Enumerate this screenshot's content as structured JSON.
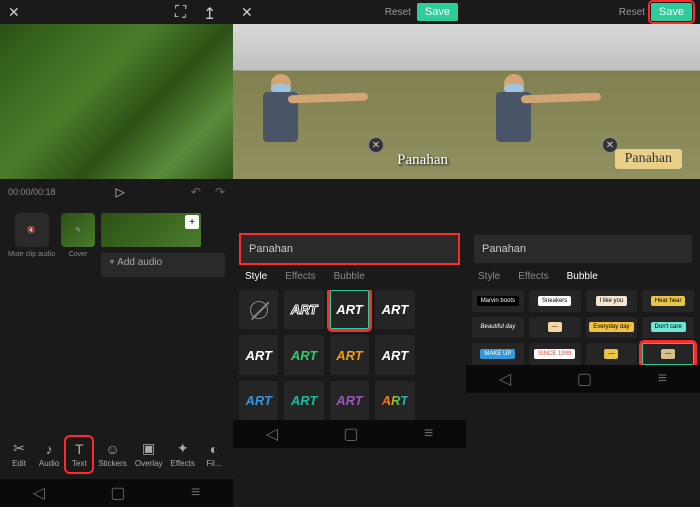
{
  "common": {
    "reset": "Reset",
    "save": "Save"
  },
  "panel1": {
    "timecode": "00:00/00:18",
    "muteClip": "Mute clip audio",
    "cover": "Cover",
    "addAudio": "+ Add audio",
    "tools": {
      "edit": "Edit",
      "audio": "Audio",
      "text": "Text",
      "stickers": "Stickers",
      "overlay": "Overlay",
      "effects": "Effects",
      "filters": "Fil..."
    }
  },
  "panel2": {
    "textValue": "Panahan",
    "overlayText": "Panahan",
    "tabs": {
      "style": "Style",
      "effects": "Effects",
      "bubble": "Bubble"
    },
    "artLabel": "ART"
  },
  "panel3": {
    "textValue": "Panahan",
    "overlayText": "Panahan",
    "tabs": {
      "style": "Style",
      "effects": "Effects",
      "bubble": "Bubble"
    },
    "bubbles": [
      [
        "Marvin boots",
        "Sneakers",
        "I like you",
        "Hear hear"
      ],
      [
        "Beautiful day",
        "—",
        "Everyday day",
        "Don't care"
      ],
      [
        "MAKE UP",
        "SINCE 1999",
        "—",
        "—"
      ]
    ]
  },
  "colors": {
    "accent": "#2ecc9b",
    "highlight": "#ff2a2a"
  }
}
